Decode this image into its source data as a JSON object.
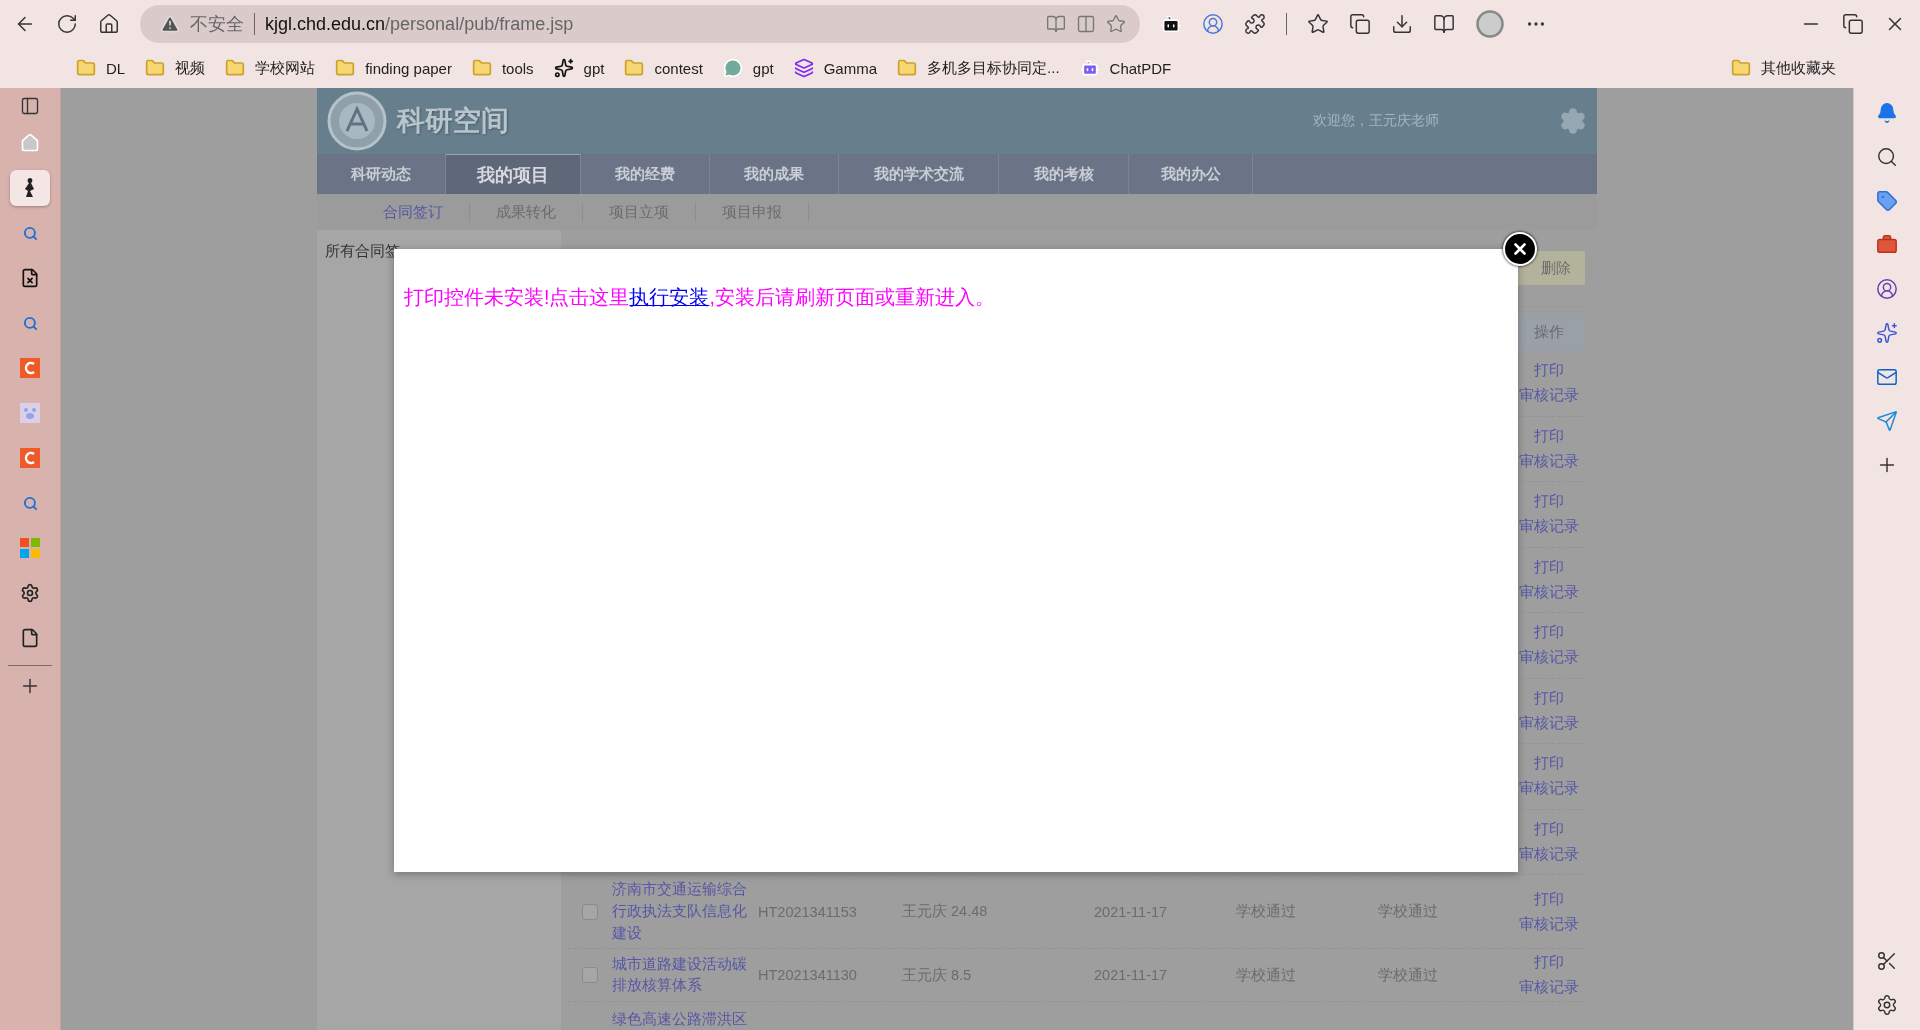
{
  "browser": {
    "address_bar": {
      "security_label": "不安全",
      "host": "kjgl.chd.edu.cn",
      "path": "/personal/pub/frame.jsp"
    },
    "bookmarks": [
      {
        "label": "DL",
        "kind": "folder"
      },
      {
        "label": "视频",
        "kind": "folder"
      },
      {
        "label": "学校网站",
        "kind": "folder"
      },
      {
        "label": "finding paper",
        "kind": "folder"
      },
      {
        "label": "tools",
        "kind": "folder"
      },
      {
        "label": "gpt",
        "kind": "openai"
      },
      {
        "label": "contest",
        "kind": "folder"
      },
      {
        "label": "gpt",
        "kind": "chat"
      },
      {
        "label": "Gamma",
        "kind": "gamma"
      },
      {
        "label": "多机多目标协同定...",
        "kind": "folder"
      },
      {
        "label": "ChatPDF",
        "kind": "chatpdf"
      }
    ],
    "other_bookmarks": "其他收藏夹",
    "vertical_tabs": [
      {
        "kind": "home",
        "selected": false
      },
      {
        "kind": "figure",
        "selected": true
      },
      {
        "kind": "search",
        "selected": false
      },
      {
        "kind": "file",
        "selected": false
      },
      {
        "kind": "search",
        "selected": false
      },
      {
        "kind": "letter",
        "selected": false
      },
      {
        "kind": "paw",
        "selected": false
      },
      {
        "kind": "letter",
        "selected": false
      },
      {
        "kind": "search",
        "selected": false
      },
      {
        "kind": "tiles",
        "selected": false
      },
      {
        "kind": "gear",
        "selected": false
      },
      {
        "kind": "page",
        "selected": false
      }
    ]
  },
  "site": {
    "title": "科研空间",
    "welcome": "欢迎您，王元庆老师",
    "nav": [
      {
        "label": "科研动态",
        "selected": false
      },
      {
        "label": "我的项目",
        "selected": true
      },
      {
        "label": "我的经费",
        "selected": false
      },
      {
        "label": "我的成果",
        "selected": false
      },
      {
        "label": "我的学术交流",
        "selected": false
      },
      {
        "label": "我的考核",
        "selected": false
      },
      {
        "label": "我的办公",
        "selected": false
      }
    ],
    "subnav": [
      {
        "label": "合同签订",
        "selected": true
      },
      {
        "label": "成果转化",
        "selected": false
      },
      {
        "label": "项目立项",
        "selected": false
      },
      {
        "label": "项目申报",
        "selected": false
      }
    ],
    "left_panel_title": "所有合同签",
    "delete_button": "删除",
    "table": {
      "action_header": "操作",
      "rows": [
        {
          "actions": [
            "打印",
            "审核记录"
          ]
        },
        {
          "actions": [
            "打印",
            "审核记录"
          ]
        },
        {
          "actions": [
            "打印",
            "审核记录"
          ]
        },
        {
          "actions": [
            "打印",
            "审核记录"
          ]
        },
        {
          "actions": [
            "打印",
            "审核记录"
          ]
        },
        {
          "actions": [
            "打印",
            "审核记录"
          ]
        },
        {
          "actions": [
            "打印",
            "审核记录"
          ]
        },
        {
          "actions": [
            "打印",
            "审核记录"
          ]
        },
        {
          "checked": false,
          "name": "济南市交通运输综合行政执法支队信息化建设",
          "code": "HT2021341153",
          "person": "王元庆 24.48",
          "date": "2021-11-17",
          "status_1": "学校通过",
          "status_2": "学校通过",
          "actions": [
            "打印",
            "审核记录"
          ]
        },
        {
          "checked": false,
          "name": "城市道路建设活动碳排放核算体系",
          "code": "HT2021341130",
          "person": "王元庆 8.5",
          "date": "2021-11-17",
          "status_1": "学校通过",
          "status_2": "学校通过",
          "actions": [
            "打印",
            "审核记录"
          ]
        },
        {
          "name": "绿色高速公路滞洪区"
        }
      ]
    }
  },
  "dialog": {
    "message_before": "打印控件未安装!点击这里",
    "link": "执行安装",
    "message_after": ",安装后请刷新页面或重新进入。"
  }
}
